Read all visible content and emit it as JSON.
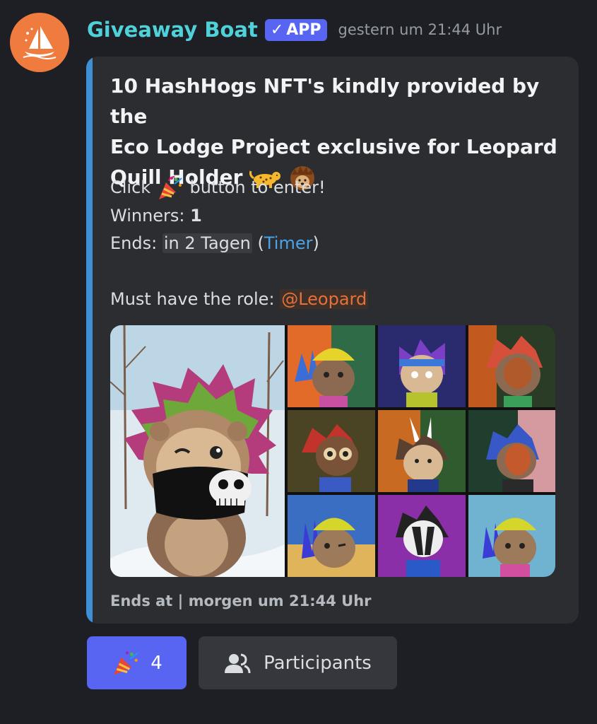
{
  "message": {
    "author": "Giveaway Boat",
    "badge": "APP",
    "timestamp": "gestern um 21:44 Uhr"
  },
  "embed": {
    "title_line1": "10 HashHogs NFT's kindly provided by the",
    "title_line2": "Eco Lodge Project exclusive for Leopard",
    "title_line3": "Quill Holder",
    "click_before": "Click",
    "click_after": "button to enter!",
    "winners_label": "Winners:",
    "winners_value": "1",
    "ends_label": "Ends:",
    "ends_value": "in 2 Tagen",
    "timer_open": "(",
    "timer_link": "Timer",
    "timer_close": ")",
    "role_label": "Must have the role:",
    "role_mention": "@Leopard",
    "footer": "Ends at | morgen um 21:44 Uhr"
  },
  "buttons": {
    "enter_count": "4",
    "participants_label": "Participants"
  },
  "colors": {
    "username": "#4fd1d9",
    "accent": "#5865f2",
    "embed_bar": "#3f8fd4",
    "mention": "#e8703a"
  },
  "icons": [
    "sailboat-logo",
    "check-icon",
    "leopard-emoji",
    "hedgehog-emoji",
    "party-popper-icon",
    "people-icon"
  ]
}
